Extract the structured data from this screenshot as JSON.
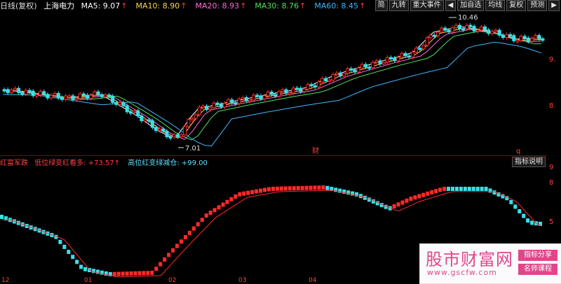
{
  "header": {
    "period": "日线(复权)",
    "stock_name": "上海电力",
    "ma": [
      {
        "label": "MA5:",
        "value": "9.07",
        "color": "#ffffff"
      },
      {
        "label": "MA10:",
        "value": "8.90",
        "color": "#ffd84a"
      },
      {
        "label": "MA20:",
        "value": "8.93",
        "color": "#ff6bd8"
      },
      {
        "label": "MA30:",
        "value": "8.76",
        "color": "#4ee25a"
      },
      {
        "label": "MA60:",
        "value": "8.45",
        "color": "#3fb7ff"
      }
    ],
    "arrow": "↑"
  },
  "toolbar": [
    "简",
    "九转",
    "重大事件",
    "加自选",
    "均线",
    "复权",
    "预测"
  ],
  "window_controls": [
    "◀",
    "▶"
  ],
  "price_chart": {
    "high_label": "10.46",
    "low_label": "7.01",
    "marker_cai": "财",
    "marker_q": "q",
    "right_ticks": [
      "9.",
      "8."
    ],
    "colors": {
      "up": "#ff2a2a",
      "down": "#38e0e8"
    }
  },
  "indicator": {
    "left_text": "红富军跌",
    "item1": "低位绿变红看多:",
    "item1_val": "+73.57",
    "item2": "高位红变绿减仓:",
    "item2_val": "+99.00",
    "help_btn": "指标说明",
    "right_ticks": [
      "9",
      "8",
      "5"
    ]
  },
  "date_axis": [
    "12",
    "01",
    "02",
    "03",
    "04"
  ],
  "watermark": {
    "title": "股市财富网",
    "url": "www.gscfw.com",
    "tag1": "指标分享",
    "tag2": "名师课程"
  },
  "chart_data": {
    "type": "line",
    "title": "",
    "ma_values": {
      "MA5": 9.07,
      "MA10": 8.9,
      "MA20": 8.93,
      "MA30": 8.76,
      "MA60": 8.45
    },
    "annotations": [
      {
        "text": "10.46",
        "kind": "high"
      },
      {
        "text": "7.01",
        "kind": "low"
      }
    ],
    "indicator_values": {
      "低位绿变红看多": 73.57,
      "高位红变绿减仓": 99.0
    }
  }
}
